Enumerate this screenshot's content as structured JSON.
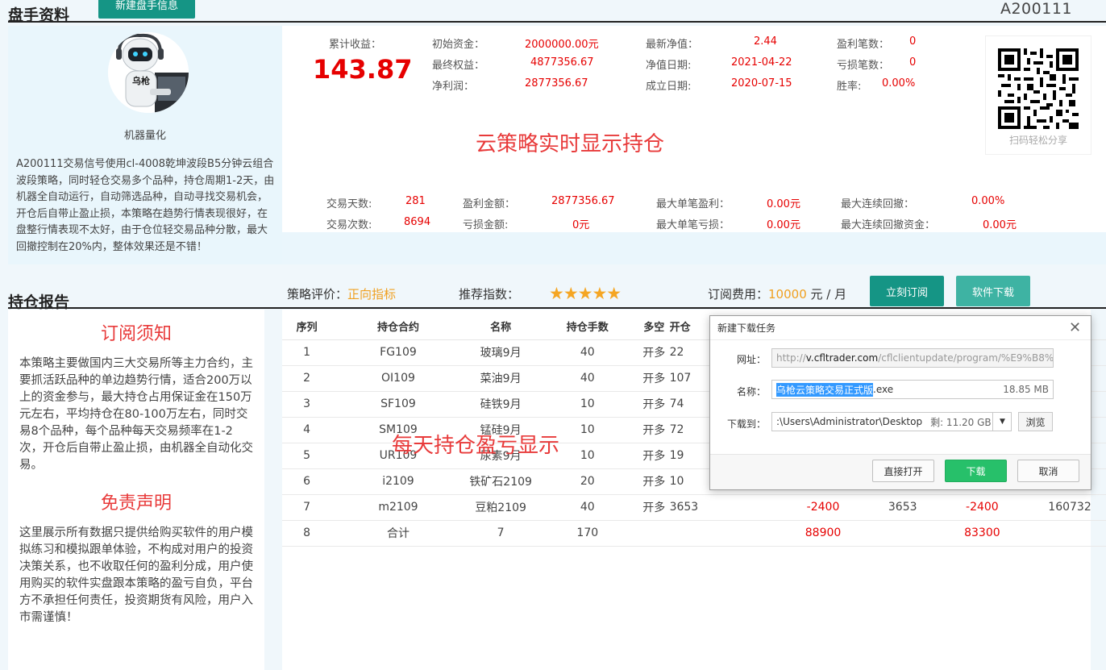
{
  "header": {
    "section_title": "盘手资料",
    "new_button": "新建盘手信息",
    "account_id": "A200111"
  },
  "profile": {
    "avatar_text": "乌枪",
    "name": "机器量化",
    "description": "A200111交易信号使用cl-4008乾坤波段B5分钟云组合波段策略，同时轻仓交易多个品种，持仓周期1-2天，由机器全自动运行，自动筛选品种，自动寻找交易机会，开仓后自带止盈止损，本策略在趋势行情表现很好，在盘整行情表现不太好，由于仓位轻交易品种分散，最大回撤控制在20%内，整体效果还是不错！"
  },
  "stats": {
    "cum_label": "累计收益：",
    "cum_value": "143.87",
    "rows_top": [
      {
        "label": "初始资金：",
        "value": "2000000.00元"
      },
      {
        "label": "最终权益：",
        "value": "4877356.67"
      },
      {
        "label": "净利润：",
        "value": "2877356.67"
      },
      {
        "label": "最新净值：",
        "value": "2.44"
      },
      {
        "label": "净值日期:",
        "value": "2021-04-22"
      },
      {
        "label": "成立日期:",
        "value": "2020-07-15"
      },
      {
        "label": "盈利笔数：",
        "value": "0"
      },
      {
        "label": "亏损笔数：",
        "value": "0"
      },
      {
        "label": "胜率:",
        "value": "0.00%"
      }
    ],
    "rows_bottom": [
      {
        "label": "交易天数:",
        "value": "281"
      },
      {
        "label": "交易次数:",
        "value": "8694"
      },
      {
        "label": "盈利金额：",
        "value": "2877356.67"
      },
      {
        "label": "亏损金额:",
        "value": "0元"
      },
      {
        "label": "最大单笔盈利：",
        "value": "0.00元"
      },
      {
        "label": "最大单笔亏损：",
        "value": "0.00元"
      },
      {
        "label": "最大连续回撤：",
        "value": "0.00%"
      },
      {
        "label": "最大连续回撤资金：",
        "value": "0.00元"
      }
    ],
    "overlay_live": "云策略实时显示持仓",
    "qr_caption": "扫码轻松分享"
  },
  "rating_bar": {
    "section_title": "持仓报告",
    "rating_label": "策略评价：",
    "rating_value": "正向指标",
    "recommend_label": "推荐指数：",
    "stars": "★★★★★",
    "fee_label": "订阅费用：",
    "fee_value": "10000",
    "fee_unit": " 元 / 月",
    "subscribe_button": "立刻订阅",
    "download_button": "软件下载"
  },
  "notice": {
    "title": "订阅须知",
    "text": "本策略主要做国内三大交易所等主力合约，主要抓活跃品种的单边趋势行情，适合200万以上的资金参与，最大持仓占用保证金在150万元左右，平均持仓在80-100万左右，同时交易8个品种，每个品种每天交易频率在1-2次，开仓后自带止盈止损，由机器全自动化交易。",
    "disclaimer_title": "免责声明",
    "disclaimer_text": "这里展示所有数据只提供给购买软件的用户模拟练习和模拟跟单体验，不构成对用户的投资决策关系，也不收取任何的盈利分成，用户使用购买的软件实盘跟本策略的盈亏自负，平台方不承担任何责任，投资期货有风险，用户入市需谨慎！"
  },
  "table": {
    "headers": [
      "序列",
      "持仓合约",
      "名称",
      "持仓手数",
      "多空",
      "开仓"
    ],
    "rows": [
      [
        "1",
        "FG109",
        "玻璃9月",
        "40",
        "开多",
        "22",
        "",
        "",
        "",
        ""
      ],
      [
        "2",
        "OI109",
        "菜油9月",
        "40",
        "开多",
        "107",
        "",
        "",
        "",
        ""
      ],
      [
        "3",
        "SF109",
        "硅铁9月",
        "10",
        "开多",
        "74",
        "",
        "",
        "",
        ""
      ],
      [
        "4",
        "SM109",
        "锰硅9月",
        "10",
        "开多",
        "72",
        "",
        "",
        "",
        ""
      ],
      [
        "5",
        "UR109",
        "尿素9月",
        "10",
        "开多",
        "19",
        "",
        "",
        "",
        ""
      ],
      [
        "6",
        "i2109",
        "铁矿石2109",
        "20",
        "开多",
        "10",
        "",
        "",
        "",
        ""
      ],
      [
        "7",
        "m2109",
        "豆粕2109",
        "40",
        "开多",
        "3653",
        "-2400",
        "3653",
        "-2400",
        "160732"
      ],
      [
        "8",
        "合计",
        "7",
        "170",
        "",
        "",
        "88900",
        "",
        "83300",
        ""
      ]
    ],
    "overlay_daily": "每天持仓盈亏显示"
  },
  "dialog": {
    "title": "新建下载任务",
    "url_label": "网址：",
    "url_prefix": "http://",
    "url_host": "v.cfltrader.com",
    "url_path": "/cflclientupdate/program/%E9%B8%9",
    "name_label": "名称：",
    "name_selected": "乌枪云策略交易正式版",
    "name_ext": ".exe",
    "name_size": "18.85 MB",
    "dest_label": "下载到：",
    "dest_path": ":\\Users\\Administrator\\Desktop",
    "dest_free": "剩: 11.20 GB",
    "browse": "浏览",
    "open_direct": "直接打开",
    "download": "下载",
    "cancel": "取消"
  }
}
